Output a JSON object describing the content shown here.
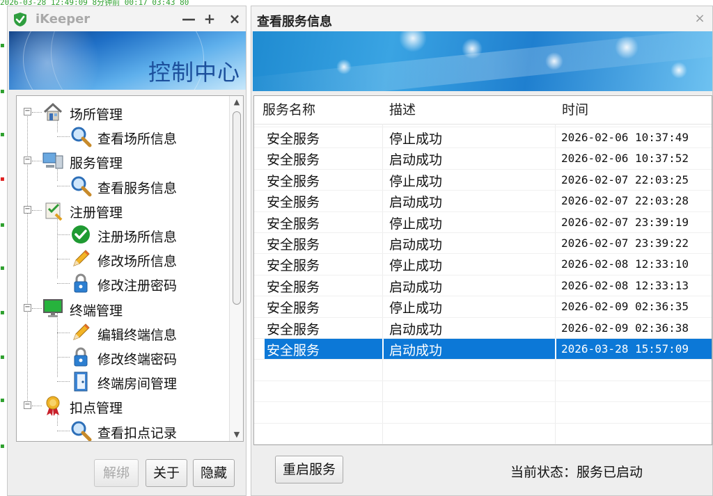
{
  "background": {
    "top_text": "2026-03-28 12:49:09      8分钟前         00:17              03:43             80"
  },
  "left_window": {
    "title": "iKeeper",
    "controls": {
      "minimize": "—",
      "maximize": "+",
      "close": "×"
    },
    "banner_text": "控制中心",
    "tree": [
      {
        "label": "场所管理",
        "level": 0,
        "icon": "house-icon",
        "expanded": true
      },
      {
        "label": "查看场所信息",
        "level": 1,
        "icon": "magnifier-icon"
      },
      {
        "label": "服务管理",
        "level": 0,
        "icon": "computer-icon",
        "expanded": true
      },
      {
        "label": "查看服务信息",
        "level": 1,
        "icon": "magnifier-icon"
      },
      {
        "label": "注册管理",
        "level": 0,
        "icon": "register-icon",
        "expanded": true
      },
      {
        "label": "注册场所信息",
        "level": 1,
        "icon": "green-check-icon"
      },
      {
        "label": "修改场所信息",
        "level": 1,
        "icon": "pencil-icon"
      },
      {
        "label": "修改注册密码",
        "level": 1,
        "icon": "lock-icon"
      },
      {
        "label": "终端管理",
        "level": 0,
        "icon": "monitor-icon",
        "expanded": true
      },
      {
        "label": "编辑终端信息",
        "level": 1,
        "icon": "pencil-icon"
      },
      {
        "label": "修改终端密码",
        "level": 1,
        "icon": "lock-icon"
      },
      {
        "label": "终端房间管理",
        "level": 1,
        "icon": "door-icon"
      },
      {
        "label": "扣点管理",
        "level": 0,
        "icon": "ribbon-icon",
        "expanded": true
      },
      {
        "label": "查看扣点记录",
        "level": 1,
        "icon": "magnifier-icon"
      }
    ],
    "buttons": {
      "unbind": "解绑",
      "about": "关于",
      "hide": "隐藏"
    }
  },
  "right_window": {
    "title": "查看服务信息",
    "close": "×",
    "table": {
      "columns": [
        "服务名称",
        "描述",
        "时间"
      ],
      "rows": [
        [
          "安全服务",
          "停止成功",
          "2026-02-06 10:37:49"
        ],
        [
          "安全服务",
          "启动成功",
          "2026-02-06 10:37:52"
        ],
        [
          "安全服务",
          "停止成功",
          "2026-02-07 22:03:25"
        ],
        [
          "安全服务",
          "启动成功",
          "2026-02-07 22:03:28"
        ],
        [
          "安全服务",
          "停止成功",
          "2026-02-07 23:39:19"
        ],
        [
          "安全服务",
          "启动成功",
          "2026-02-07 23:39:22"
        ],
        [
          "安全服务",
          "停止成功",
          "2026-02-08 12:33:10"
        ],
        [
          "安全服务",
          "启动成功",
          "2026-02-08 12:33:13"
        ],
        [
          "安全服务",
          "停止成功",
          "2026-02-09 02:36:35"
        ],
        [
          "安全服务",
          "启动成功",
          "2026-02-09 02:36:38"
        ],
        [
          "安全服务",
          "启动成功",
          "2026-03-28 15:57:09"
        ]
      ],
      "selected_row": 10
    },
    "restart_button": "重启服务",
    "status_text": "当前状态：服务已启动"
  },
  "colors": {
    "selection": "#0c78d7",
    "accent_green": "#2ea02e",
    "banner_text": "#1c4f9c"
  }
}
